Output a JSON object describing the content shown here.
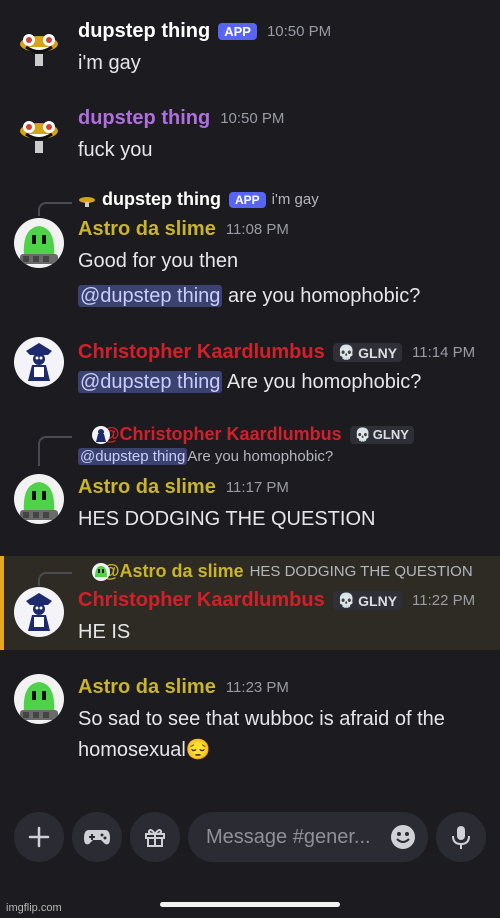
{
  "messages": [
    {
      "author": "dupstep thing",
      "badge": "APP",
      "time": "10:50 PM",
      "text": "i'm gay"
    },
    {
      "author": "dupstep thing",
      "time": "10:50 PM",
      "text": "fuck you"
    },
    {
      "reply": {
        "author": "dupstep thing",
        "badge": "APP",
        "text": "i'm gay"
      },
      "author": "Astro da slime",
      "time": "11:08 PM",
      "text1": "Good for you then",
      "mention": "@dupstep thing",
      "text2": " are you homophobic?"
    },
    {
      "author": "Christopher Kaardlumbus",
      "tag": "GLNY",
      "time": "11:14 PM",
      "mention": "@dupstep thing",
      "text": " Are you homophobic?"
    },
    {
      "reply": {
        "author": "@Christopher Kaardlumbus",
        "tag": "GLNY",
        "mention": "@dupstep thing",
        "text": " Are you homophobic?"
      },
      "author": "Astro da slime",
      "time": "11:17 PM",
      "text": "HES DODGING THE QUESTION"
    },
    {
      "reply": {
        "author": "@Astro da slime",
        "text": "HES DODGING THE QUESTION"
      },
      "author": "Christopher Kaardlumbus",
      "tag": "GLNY",
      "time": "11:22 PM",
      "text": "HE IS"
    },
    {
      "author": "Astro da slime",
      "time": "11:23 PM",
      "line1": "So sad to see that wubboc is afraid of the",
      "line2": "homosexual",
      "emoji": "😔"
    }
  ],
  "composer": {
    "placeholder": "Message #gener..."
  },
  "watermark": "imgflip.com",
  "colors": {
    "app_badge": "#5865f2",
    "highlight": "#e8a723",
    "astro_name": "#c9b42a",
    "christopher_name": "#d2202a",
    "dupstep_name_2": "#b06ee0"
  },
  "icons": [
    "plus-icon",
    "gamepad-icon",
    "gift-icon",
    "emoji-icon",
    "microphone-icon",
    "skull-icon"
  ]
}
